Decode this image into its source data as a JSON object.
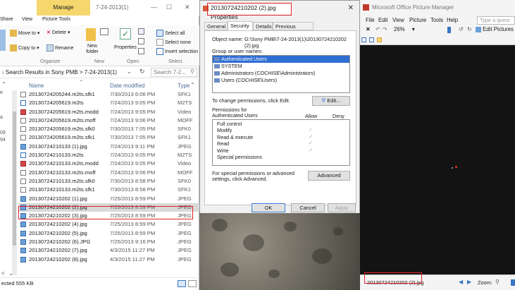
{
  "explorer": {
    "manage_tab": "Manage",
    "window_title": "7-24-2013(1)",
    "tabs": [
      "Share",
      "View",
      "Picture Tools"
    ],
    "ribbon": {
      "move_to": "Move to",
      "delete": "Delete",
      "copy_to": "Copy to",
      "rename": "Rename",
      "new_folder": "New folder",
      "properties": "Properties",
      "select_all": "Select all",
      "select_none": "Select none",
      "invert_selection": "Invert selection",
      "groups": [
        "Organize",
        "New",
        "Open",
        "Select"
      ]
    },
    "address": "Search Results in Sony PMB  >  7-24-2013(1)",
    "search_placeholder": "Search 7-2...",
    "columns": {
      "name": "Name",
      "date": "Date modified",
      "type": "Type"
    },
    "files": [
      {
        "name": "20130724205244.m2ts.sfk1",
        "date": "7/30/2013 6:06 PM",
        "type": "SFK1",
        "icon": "file"
      },
      {
        "name": "20130724205619.m2ts",
        "date": "7/24/2013 9:05 PM",
        "type": "M2TS",
        "icon": "video"
      },
      {
        "name": "20130724205619.m2ts.modd",
        "date": "7/24/2013 9:05 PM",
        "type": "Video",
        "icon": "red"
      },
      {
        "name": "20130724205619.m2ts.moff",
        "date": "7/24/2013 9:06 PM",
        "type": "MOFF",
        "icon": "file"
      },
      {
        "name": "20130724205619.m2ts.sfk0",
        "date": "7/30/2013 7:05 PM",
        "type": "SFK0",
        "icon": "file"
      },
      {
        "name": "20130724205619.m2ts.sfk1",
        "date": "7/30/2013 7:05 PM",
        "type": "SFK1",
        "icon": "file"
      },
      {
        "name": "20130724210133 (1).jpg",
        "date": "7/24/2013 9:11 PM",
        "type": "JPEG",
        "icon": "jpg"
      },
      {
        "name": "20130724210133.m2ts",
        "date": "7/24/2013 9:05 PM",
        "type": "M2TS",
        "icon": "video"
      },
      {
        "name": "20130724210133.m2ts.modd",
        "date": "7/24/2013 9:05 PM",
        "type": "Video",
        "icon": "red"
      },
      {
        "name": "20130724210133.m2ts.moff",
        "date": "7/24/2013 9:06 PM",
        "type": "MOFF",
        "icon": "file"
      },
      {
        "name": "20130724210133.m2ts.sfk0",
        "date": "7/30/2013 8:58 PM",
        "type": "SFK0",
        "icon": "file"
      },
      {
        "name": "20130724210133.m2ts.sfk1",
        "date": "7/30/2013 8:58 PM",
        "type": "SFK1",
        "icon": "file"
      },
      {
        "name": "20130724210202 (1).jpg",
        "date": "7/25/2013 8:59 PM",
        "type": "JPEG",
        "icon": "jpg"
      },
      {
        "name": "20130724210202 (2).jpg",
        "date": "7/25/2013 8:59 PM",
        "type": "JPEG",
        "icon": "jpg"
      },
      {
        "name": "20130724210202 (3).jpg",
        "date": "7/25/2013 8:59 PM",
        "type": "JPEG",
        "icon": "jpg"
      },
      {
        "name": "20130724210202 (4).jpg",
        "date": "7/25/2013 8:59 PM",
        "type": "JPEG",
        "icon": "jpg"
      },
      {
        "name": "20130724210202 (5).jpg",
        "date": "7/25/2013 8:59 PM",
        "type": "JPEG",
        "icon": "jpg"
      },
      {
        "name": "20130724210202 (6).JPG",
        "date": "7/25/2013 9:16 PM",
        "type": "JPEG",
        "icon": "jpg"
      },
      {
        "name": "20130724210202 (7).jpg",
        "date": "4/3/2015 11:27 PM",
        "type": "JPEG",
        "icon": "jpg"
      },
      {
        "name": "20130724210202 (8).jpg",
        "date": "4/3/2015 11:27 PM",
        "type": "JPEG",
        "icon": "jpg"
      }
    ],
    "status": "ected 555 KB"
  },
  "properties": {
    "title": "20130724210202 (2).jpg Properties",
    "tabs": [
      "General",
      "Security",
      "Details",
      "Previous Versions"
    ],
    "object_name_label": "Object name:",
    "object_name_value": "G:\\Sony PMB\\7-24-2013(1)\\20130724210202 (2).jpg",
    "group_label": "Group or user names:",
    "groups": [
      "Authenticated Users",
      "SYSTEM",
      "Administrators (COCHISE\\Administrators)",
      "Users (COCHISE\\Users)"
    ],
    "change_text": "To change permissions, click Edit.",
    "edit_button": "Edit...",
    "perm_label": "Permissions for Authenticated Users",
    "allow": "Allow",
    "deny": "Deny",
    "permissions": [
      {
        "name": "Full control",
        "allow": false
      },
      {
        "name": "Modify",
        "allow": true
      },
      {
        "name": "Read & execute",
        "allow": true
      },
      {
        "name": "Read",
        "allow": true
      },
      {
        "name": "Write",
        "allow": true
      },
      {
        "name": "Special permissions",
        "allow": false
      }
    ],
    "advanced_text": "For special permissions or advanced settings, click Advanced.",
    "advanced_button": "Advanced",
    "ok": "OK",
    "cancel": "Cancel",
    "apply": "Apply"
  },
  "picture_manager": {
    "title": "Microsoft Office Picture Manager",
    "menu": [
      "File",
      "Edit",
      "View",
      "Picture",
      "Tools",
      "Help"
    ],
    "question_placeholder": "Type a quest",
    "zoom": "26%",
    "edit_pictures": "Edit Pictures",
    "filename": "20130724210202 (2).jpg",
    "zoom_label": "Zoom:"
  }
}
